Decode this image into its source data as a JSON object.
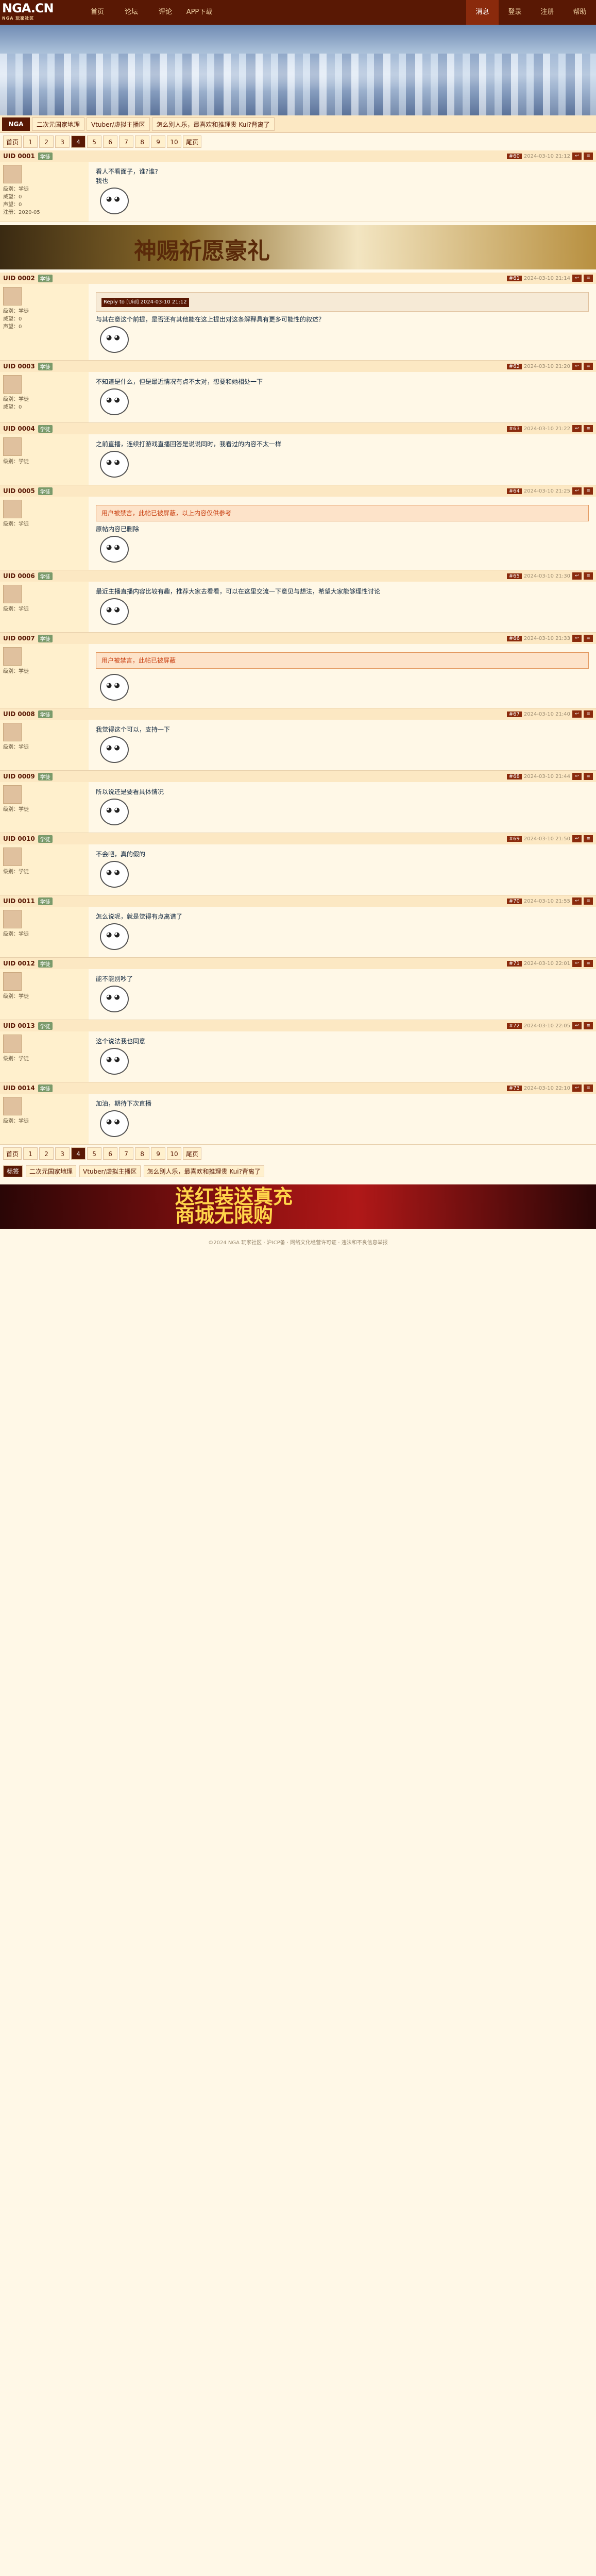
{
  "site": {
    "logo": "NGA.CN",
    "sub": "NGA 玩家社区"
  },
  "topnav": [
    "首页",
    "论坛",
    "评论",
    "APP下载"
  ],
  "rightnav": [
    "消息",
    "登录",
    "注册",
    "帮助"
  ],
  "breadcrumb": {
    "home": "NGA",
    "segments": [
      "二次元国家地理",
      "Vtuber/虚拟主播区",
      "怎么别人乐，最喜欢和推理贵 Kui?背离了"
    ]
  },
  "pager": {
    "first": "首页",
    "pages": [
      "1",
      "2",
      "3",
      "4",
      "5",
      "6",
      "7",
      "8",
      "9",
      "10"
    ],
    "current": "4",
    "last": "尾页"
  },
  "posts": [
    {
      "user": "UID 0001",
      "badge": "学徒",
      "floor": "#60",
      "time": "2024-03-10 21:12",
      "side": [
        "级别：学徒",
        "威望：0",
        "声望：0",
        "注册：2020-05"
      ],
      "text": "看人不看面子，谁?谁?",
      "note": "我也"
    },
    {
      "user": "UID 0002",
      "badge": "学徒",
      "floor": "#61",
      "time": "2024-03-10 21:14",
      "side": [
        "级别：学徒",
        "威望：0",
        "声望：0"
      ],
      "quote": "Reply to [Uid] 2024-03-10 21:12",
      "text": "与其在意这个前提，是否还有其他能在这上提出对这条解释具有更多可能性的叙述？"
    },
    {
      "user": "UID 0003",
      "badge": "学徒",
      "floor": "#62",
      "time": "2024-03-10 21:20",
      "side": [
        "级别：学徒",
        "威望：0"
      ],
      "text": "不知道是什么，但是最近情况有点不太对，想要和她相处一下"
    },
    {
      "user": "UID 0004",
      "badge": "学徒",
      "floor": "#63",
      "time": "2024-03-10 21:22",
      "side": [
        "级别：学徒"
      ],
      "text": "之前直播，连续打游戏直播回答是说说同时，我看过的内容不太一样"
    },
    {
      "user": "UID 0005",
      "badge": "学徒",
      "floor": "#64",
      "time": "2024-03-10 21:25",
      "side": [
        "级别：学徒"
      ],
      "warn": "用户被禁言，此帖已被屏蔽，以上内容仅供参考",
      "text": "原帖内容已删除"
    },
    {
      "user": "UID 0006",
      "badge": "学徒",
      "floor": "#65",
      "time": "2024-03-10 21:30",
      "side": [
        "级别：学徒"
      ],
      "text": "最近主播直播内容比较有趣，推荐大家去看看，可以在这里交流一下意见与想法，希望大家能够理性讨论"
    },
    {
      "user": "UID 0007",
      "badge": "学徒",
      "floor": "#66",
      "time": "2024-03-10 21:33",
      "side": [
        "级别：学徒"
      ],
      "warn": "用户被禁言，此帖已被屏蔽",
      "text": ""
    },
    {
      "user": "UID 0008",
      "badge": "学徒",
      "floor": "#67",
      "time": "2024-03-10 21:40",
      "side": [
        "级别：学徒"
      ],
      "text": "我觉得这个可以，支持一下"
    },
    {
      "user": "UID 0009",
      "badge": "学徒",
      "floor": "#68",
      "time": "2024-03-10 21:44",
      "side": [
        "级别：学徒"
      ],
      "text": "所以说还是要看具体情况"
    },
    {
      "user": "UID 0010",
      "badge": "学徒",
      "floor": "#69",
      "time": "2024-03-10 21:50",
      "side": [
        "级别：学徒"
      ],
      "text": "不会吧，真的假的"
    },
    {
      "user": "UID 0011",
      "badge": "学徒",
      "floor": "#70",
      "time": "2024-03-10 21:55",
      "side": [
        "级别：学徒"
      ],
      "text": "怎么说呢，就是觉得有点离谱了"
    },
    {
      "user": "UID 0012",
      "badge": "学徒",
      "floor": "#71",
      "time": "2024-03-10 22:01",
      "side": [
        "级别：学徒"
      ],
      "text": "能不能别吵了"
    },
    {
      "user": "UID 0013",
      "badge": "学徒",
      "floor": "#72",
      "time": "2024-03-10 22:05",
      "side": [
        "级别：学徒"
      ],
      "text": "这个说法我也同意"
    },
    {
      "user": "UID 0014",
      "badge": "学徒",
      "floor": "#73",
      "time": "2024-03-10 22:10",
      "side": [
        "级别：学徒"
      ],
      "text": "加油，期待下次直播"
    }
  ],
  "ads": {
    "a1": "神赐祈愿豪礼",
    "a2": "送红装送真充\n商城无限购"
  },
  "tags": {
    "label": "标签",
    "items": [
      "二次元国家地理",
      "Vtuber/虚拟主播区",
      "怎么别人乐，最喜欢和推理贵 Kui?背离了"
    ]
  },
  "footer": "©2024 NGA 玩家社区 · 沪ICP备 · 网络文化经营许可证 · 违法和不良信息举报"
}
